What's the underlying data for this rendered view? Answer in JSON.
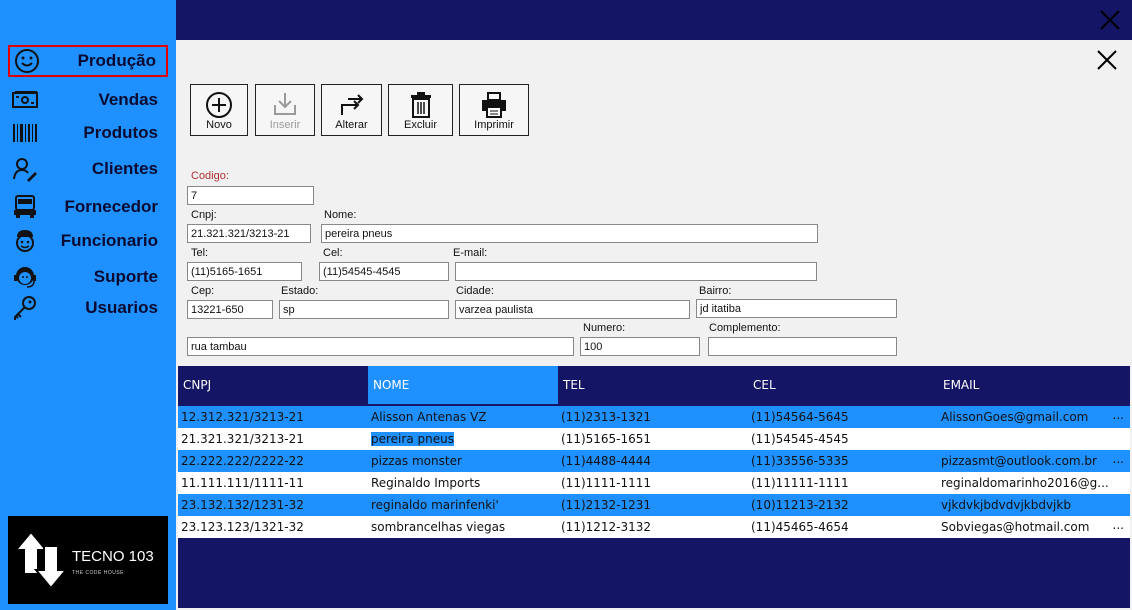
{
  "sidebar": {
    "items": [
      {
        "label": "Produção",
        "icon": "smiley-icon"
      },
      {
        "label": "Vendas",
        "icon": "money-icon"
      },
      {
        "label": "Produtos",
        "icon": "barcode-icon"
      },
      {
        "label": "Clientes",
        "icon": "user-edit-icon"
      },
      {
        "label": "Fornecedor",
        "icon": "truck-icon"
      },
      {
        "label": "Funcionario",
        "icon": "worker-icon"
      },
      {
        "label": "Suporte",
        "icon": "headset-icon"
      },
      {
        "label": "Usuarios",
        "icon": "key-icon"
      }
    ],
    "logo": {
      "title": "TECNO 103",
      "subtitle": "THE CODE HOUSE"
    }
  },
  "toolbar": {
    "novo": "Novo",
    "inserir": "Inserir",
    "alterar": "Alterar",
    "excluir": "Excluir",
    "imprimir": "Imprimir"
  },
  "form": {
    "codigo": {
      "label": "Codigo:",
      "value": "7"
    },
    "cnpj": {
      "label": "Cnpj:",
      "value": "21.321.321/3213-21"
    },
    "nome": {
      "label": "Nome:",
      "value": "pereira pneus"
    },
    "tel": {
      "label": "Tel:",
      "value": "(11)5165-1651"
    },
    "cel": {
      "label": "Cel:",
      "value": "(11)54545-4545"
    },
    "email": {
      "label": "E-mail:",
      "value": ""
    },
    "cep": {
      "label": "Cep:",
      "value": "13221-650"
    },
    "estado": {
      "label": "Estado:",
      "value": "sp"
    },
    "cidade": {
      "label": "Cidade:",
      "value": "varzea paulista"
    },
    "bairro": {
      "label": "Bairro:",
      "value": "jd itatiba"
    },
    "endereco": {
      "value": "rua tambau"
    },
    "numero": {
      "label": "Numero:",
      "value": "100"
    },
    "complemento": {
      "label": "Complemento:",
      "value": ""
    }
  },
  "grid": {
    "columns": [
      "CNPJ",
      "NOME",
      "TEL",
      "CEL",
      "EMAIL"
    ],
    "rows": [
      {
        "cnpj": "12.312.321/3213-21",
        "nome": "Alisson Antenas VZ",
        "tel": "(11)2313-1321",
        "cel": "(11)54564-5645",
        "email": "AlissonGoes@gmail.com",
        "more": "..."
      },
      {
        "cnpj": "21.321.321/3213-21",
        "nome": "pereira pneus",
        "tel": "(11)5165-1651",
        "cel": "(11)54545-4545",
        "email": "",
        "more": ""
      },
      {
        "cnpj": "22.222.222/2222-22",
        "nome": "pizzas monster",
        "tel": "(11)4488-4444",
        "cel": "(11)33556-5335",
        "email": "pizzasmt@outlook.com.br",
        "more": "..."
      },
      {
        "cnpj": "11.111.111/1111-11",
        "nome": "Reginaldo Imports",
        "tel": "(11)1111-1111",
        "cel": "(11)11111-1111",
        "email": "reginaldomarinho2016@g...",
        "more": ""
      },
      {
        "cnpj": "23.132.132/1231-32",
        "nome": "reginaldo marinfenki'",
        "tel": "(11)2132-1231",
        "cel": "(10)11213-2132",
        "email": "vjkdvkjbdvdvjkbdvjkb",
        "more": ""
      },
      {
        "cnpj": "23.123.123/1321-32",
        "nome": "sombrancelhas viegas",
        "tel": "(11)1212-3132",
        "cel": "(11)45465-4654",
        "email": "Sobviegas@hotmail.com",
        "more": "..."
      }
    ]
  },
  "colors": {
    "accent": "#1e90ff",
    "dark": "#151565",
    "panel": "#f1f1f1",
    "active_border": "#e00000"
  }
}
